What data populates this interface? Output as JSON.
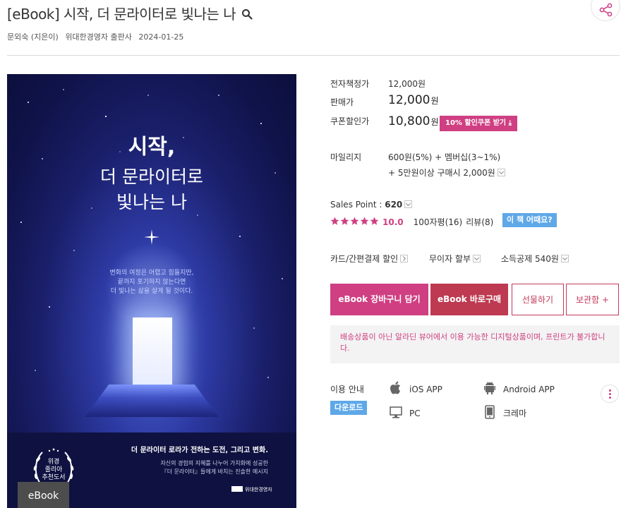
{
  "header": {
    "title": "[eBook] 시작, 더 문라이터로 빛나는 나",
    "author": "문외숙 (지은이)",
    "publisher": "위대한경영자 출판사",
    "date": "2024-01-25"
  },
  "cover": {
    "title_line1": "시작,",
    "title_line2": "더 문라이터로",
    "title_line3": "빛나는 나",
    "desc_line1": "변화의 여정은 어렵고 힘들지만,",
    "desc_line2": "끝까지 포기하지 않는다면",
    "desc_line3": "더 빛나는 삶을 살게 될 것이다.",
    "bottom_title": "더 문라이터 로라가 전하는 도전, 그리고 변화.",
    "bottom_text1": "자신의 경험의 지혜를 나누어 가치화에 성공한",
    "bottom_text2": "『더 문라이터』들에게 바치는 진솔한 메시지",
    "publisher_mark": "위대한경영자",
    "badge_line1": "위경",
    "badge_line2": "줄리아",
    "badge_line3": "추천도서",
    "ebook_tag": "eBook"
  },
  "pricing": {
    "list_price_label": "전자책정가",
    "list_price": "12,000원",
    "sale_label": "판매가",
    "sale_price": "12,000",
    "coupon_label": "쿠폰할인가",
    "coupon_price": "10,800",
    "won": "원",
    "coupon_button": "10% 할인쿠폰 받기"
  },
  "mileage": {
    "label": "마일리지",
    "line1": "600원(5%) + 멤버십(3~1%)",
    "line2": "+ 5만원이상 구매시 2,000원"
  },
  "sales": {
    "label": "Sales Point : ",
    "value": "620"
  },
  "rating": {
    "score": "10.0",
    "review_count": "100자평(16)",
    "review_link": "리뷰(8)",
    "ask_button": "이 책 어때요?",
    "stars": 5,
    "star_color": "#cf3f82"
  },
  "benefits": {
    "card_discount": "카드/간편결제 할인",
    "installment": "무이자 할부",
    "tax_deduction": "소득공제 540원"
  },
  "actions": {
    "cart": "eBook 장바구니 담기",
    "buy": "eBook 바로구매",
    "gift": "선물하기",
    "keep": "보관함 +"
  },
  "notice": "배송상품이 아닌 알라딘 뷰어에서 이용 가능한 디지털상품이며, 프린트가 불가합니다.",
  "usage": {
    "label": "이용 안내",
    "download": "다운로드",
    "ios": "iOS APP",
    "android": "Android APP",
    "pc": "PC",
    "crema": "크레마"
  },
  "colors": {
    "accent": "#cf3f82",
    "buy": "#bd3a51",
    "info_blue": "#5ea8e8"
  }
}
